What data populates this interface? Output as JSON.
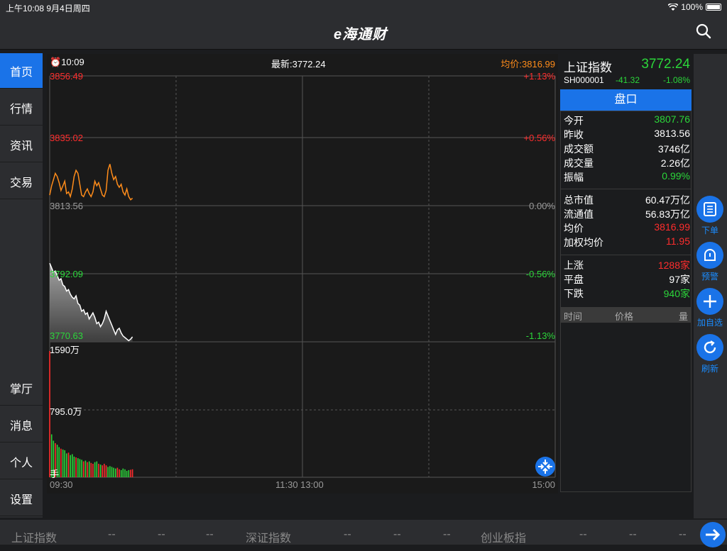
{
  "status_bar": {
    "time": "上午10:08  9月4日周四",
    "battery": "100%"
  },
  "nav": {
    "logo": "e海通财"
  },
  "sidebar": {
    "top": [
      "首页",
      "行情",
      "资讯",
      "交易"
    ],
    "bottom": [
      "掌厅",
      "消息",
      "个人",
      "设置"
    ]
  },
  "chart_header": {
    "time": "10:09",
    "latest": "最新:3772.24",
    "avg": "均价:3816.99"
  },
  "chart_labels": {
    "price_ticks": [
      "3856.49",
      "3835.02",
      "3813.56",
      "3792.09",
      "3770.63"
    ],
    "pct_ticks": [
      "+1.13%",
      "+0.56%",
      "0.00%",
      "-0.56%",
      "-1.13%"
    ],
    "vol_ticks": [
      "1590万",
      "795.0万",
      "手"
    ],
    "time_ticks": [
      "09:30",
      "11:30 13:00",
      "15:00"
    ]
  },
  "chart_data": {
    "type": "line",
    "ylim": [
      3770.63,
      3856.49
    ],
    "x_label_ticks": [
      "09:30",
      "11:30 13:00",
      "15:00"
    ],
    "series": [
      {
        "name": "price",
        "values": [
          3796.0,
          3794.5,
          3793.0,
          3793.5,
          3792.0,
          3790.5,
          3791.0,
          3789.0,
          3788.5,
          3787.0,
          3787.5,
          3786.0,
          3785.0,
          3784.5,
          3785.5,
          3783.0,
          3782.5,
          3780.5,
          3781.0,
          3779.5,
          3780.0,
          3778.0,
          3779.0,
          3780.0,
          3778.5,
          3776.5,
          3777.0,
          3775.5,
          3776.5,
          3778.0,
          3780.5,
          3779.0,
          3777.5,
          3776.0,
          3774.5,
          3773.0,
          3774.5,
          3775.0,
          3773.5,
          3772.5,
          3772.0,
          3771.5,
          3771.0,
          3771.5,
          3772.24
        ]
      },
      {
        "name": "avg",
        "values": [
          3818.0,
          3821.0,
          3823.0,
          3825.0,
          3824.0,
          3822.0,
          3819.5,
          3821.0,
          3822.5,
          3818.5,
          3819.0,
          3817.5,
          3820.0,
          3824.0,
          3826.0,
          3825.0,
          3821.5,
          3818.0,
          3817.5,
          3819.0,
          3820.0,
          3818.5,
          3817.5,
          3819.0,
          3822.5,
          3821.0,
          3822.0,
          3820.0,
          3818.0,
          3817.5,
          3819.5,
          3826.0,
          3828.0,
          3825.0,
          3823.0,
          3824.0,
          3821.5,
          3820.5,
          3821.5,
          3819.0,
          3818.0,
          3820.0,
          3817.5,
          3816.5,
          3816.99
        ]
      }
    ],
    "volume": [
      1590,
      540,
      460,
      430,
      410,
      380,
      360,
      350,
      340,
      300,
      310,
      280,
      290,
      260,
      250,
      240,
      230,
      220,
      200,
      210,
      190,
      200,
      180,
      170,
      190,
      200,
      170,
      160,
      150,
      170,
      150,
      130,
      140,
      130,
      120,
      110,
      120,
      100,
      90,
      110,
      100,
      80,
      90,
      95,
      100
    ],
    "volume_max": 1590
  },
  "quote": {
    "name": "上证指数",
    "price": "3772.24",
    "code": "SH000001",
    "change": "-41.32",
    "change_pct": "-1.08%",
    "tab": "盘口",
    "group1": [
      {
        "label": "今开",
        "value": "3807.76",
        "color": "green"
      },
      {
        "label": "昨收",
        "value": "3813.56",
        "color": "white"
      },
      {
        "label": "成交额",
        "value": "3746亿",
        "color": "white"
      },
      {
        "label": "成交量",
        "value": "2.26亿",
        "color": "white"
      },
      {
        "label": "振幅",
        "value": "0.99%",
        "color": "green"
      }
    ],
    "group2": [
      {
        "label": "总市值",
        "value": "60.47万亿",
        "color": "white"
      },
      {
        "label": "流通值",
        "value": "56.83万亿",
        "color": "white"
      },
      {
        "label": "均价",
        "value": "3816.99",
        "color": "red"
      },
      {
        "label": "加权均价",
        "value": "11.95",
        "color": "red"
      }
    ],
    "group3": [
      {
        "label": "上涨",
        "value": "1288家",
        "color": "red"
      },
      {
        "label": "平盘",
        "value": "97家",
        "color": "white"
      },
      {
        "label": "下跌",
        "value": "940家",
        "color": "green"
      }
    ],
    "trade_header": [
      "时间",
      "价格",
      "量"
    ]
  },
  "tools": [
    "下单",
    "预警",
    "加自选",
    "刷新"
  ],
  "bottom": {
    "sh": "上证指数",
    "sz": "深证指数",
    "cy": "创业板指",
    "dash": "--"
  }
}
